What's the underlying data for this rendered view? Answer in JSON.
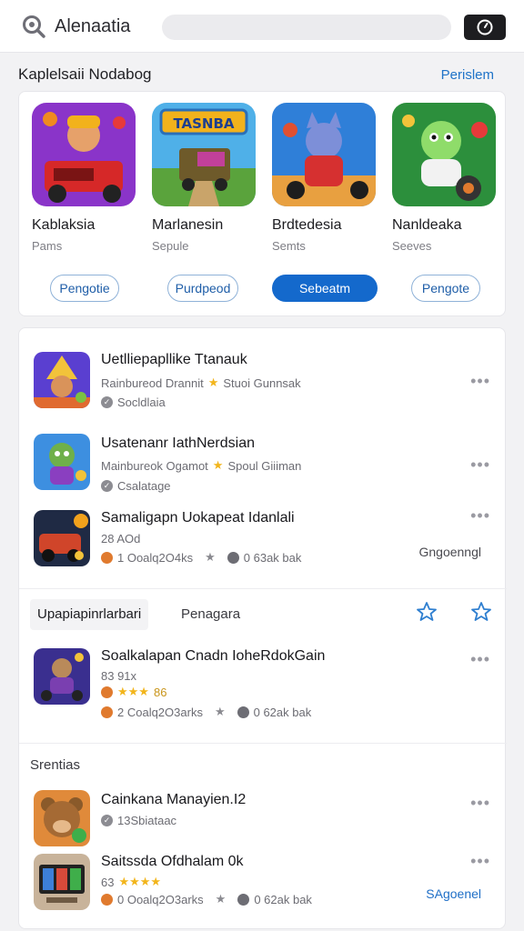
{
  "header": {
    "app_title": "Alenaatia",
    "colors": {
      "accent": "#1469cc",
      "timer_bg": "#1d1d20"
    }
  },
  "featured": {
    "title": "Kaplelsaii Nodabog",
    "see_all": "Perislem",
    "items": [
      {
        "name": "Kablaksia",
        "sub": "Pams",
        "button": "Pengotie",
        "style": "outline",
        "icon": "red-truck-game-icon"
      },
      {
        "name": "Marlanesin",
        "sub": "Sepule",
        "button": "Purdpeod",
        "style": "outline",
        "icon": "bus-adventure-game-icon"
      },
      {
        "name": "Brdtedesia",
        "sub": "Semts",
        "button": "Sebeatm",
        "style": "solid",
        "icon": "robot-cat-game-icon"
      },
      {
        "name": "Nanldeaka",
        "sub": "Seeves",
        "button": "Pengote",
        "style": "outline",
        "icon": "green-creature-game-icon"
      }
    ]
  },
  "list": {
    "rows": [
      {
        "title": "Uetlliepapllike Ttanauk",
        "line1": "Rainbureod Drannit",
        "line1b": "Stuoi Gunnsak",
        "line2": "Socldlaia",
        "icon": "wizard-game-icon"
      },
      {
        "title": "Usatenanr IathNerdsian",
        "line1": "Mainbureok Ogamot",
        "line1b": "Spoul Giiiman",
        "line2": "Csalatage",
        "icon": "monster-game-icon"
      },
      {
        "title": "Samaligapn Uokapeat Idanlali",
        "line1": "28 AOd",
        "line2a": "1 Ooalq2O4ks",
        "line2b": "0 63ak bak",
        "action": "Gngoenngl",
        "icon": "racing-game-icon"
      }
    ],
    "tabs": {
      "active": "Upapiapinrlarbari",
      "other": "Penagara"
    },
    "row4": {
      "title": "Soalkalapan Cnadn IoheRdokGain",
      "line1": "83 91x",
      "line1b": "86",
      "line2a": "2 Coalq2O3arks",
      "line2b": "0 62ak bak",
      "icon": "hero-game-icon"
    },
    "subhead": "Srentias",
    "row5": {
      "title": "Cainkana Manayien.I2",
      "line1": "13Sbiataac",
      "icon": "bear-game-icon"
    },
    "row6": {
      "title": "Saitssda Ofdhalam 0k",
      "line1": "63",
      "line2a": "0 Ooalq2O3arks",
      "line2b": "0 62ak bak",
      "action": "SAgoenel",
      "icon": "tv-game-icon"
    }
  }
}
